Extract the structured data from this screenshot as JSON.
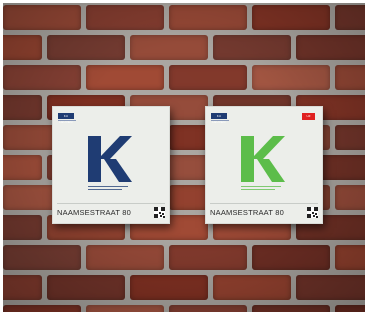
{
  "scene": {
    "description_tag": "two square KU Leuven street signs mounted on a brick wall",
    "colors": {
      "mortar": "#a8a49f",
      "brick_a": "#7f3022",
      "brick_b": "#93402d",
      "brick_c": "#6c2a1f",
      "brick_d": "#a04a35",
      "sign_background": "#eceeea",
      "left_k": "#1f3c73",
      "right_k": "#5cbd4a",
      "logo_navy": "#1f3c73",
      "tag_red": "#e02020"
    }
  },
  "signs": {
    "left": {
      "logo_text": "KU LEUVEN",
      "street": "NAAMSESTRAAT 80",
      "letter_icon": "letter-k-icon"
    },
    "right": {
      "logo_text": "KU LEUVEN",
      "red_tag_text": "UZ",
      "street": "NAAMSESTRAAT 80",
      "letter_icon": "letter-k-icon"
    }
  }
}
